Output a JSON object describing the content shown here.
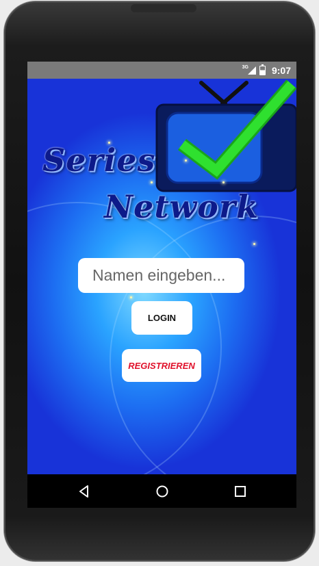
{
  "status_bar": {
    "network": "3G",
    "time": "9:07"
  },
  "logo": {
    "line1": "Series",
    "line2": "Network"
  },
  "login_form": {
    "name_placeholder": "Namen eingeben...",
    "login_label": "LOGIN",
    "register_label": "REGISTRIEREN"
  },
  "colors": {
    "background_blue": "#1d6ff2",
    "register_text": "#e0102a",
    "checkmark": "#2fe02f"
  },
  "nav_bar": {
    "back": "back-icon",
    "home": "home-icon",
    "recents": "recents-icon"
  }
}
